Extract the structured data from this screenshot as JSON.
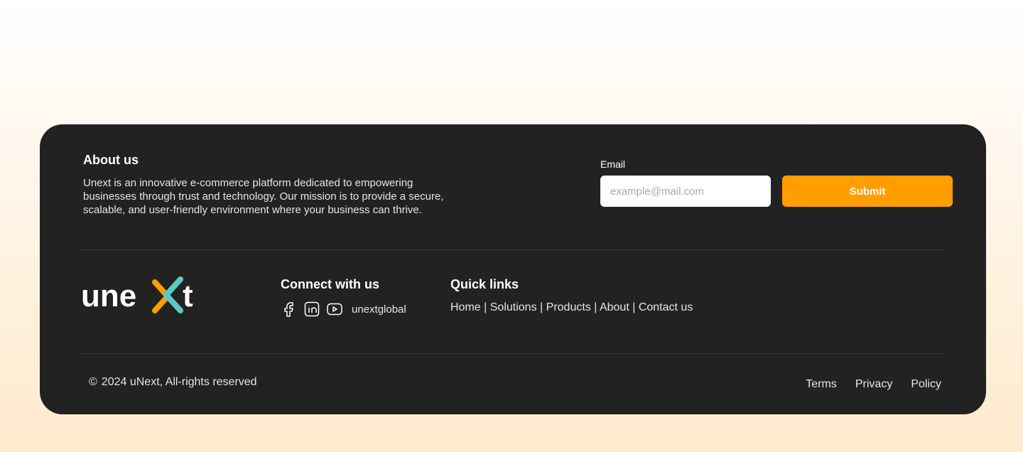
{
  "about": {
    "title": "About us",
    "text": "Unext is an innovative e-commerce platform dedicated to empowering businesses through trust and technology. Our mission is to provide a secure, scalable, and user-friendly environment where your business can thrive."
  },
  "newsletter": {
    "email_label": "Email",
    "email_placeholder": "example@mail.com",
    "email_value": "",
    "submit_label": "Submit"
  },
  "brand": {
    "logo_text": "unext",
    "colors": {
      "text": "#ffffff",
      "orange": "#ff9e00",
      "teal": "#5cc8c8"
    }
  },
  "connect": {
    "title": "Connect with us",
    "icons": [
      "facebook-icon",
      "linkedin-icon",
      "youtube-icon"
    ],
    "handle": "unextglobal"
  },
  "quick_links": {
    "title": "Quick links",
    "items": [
      "Home",
      "Solutions",
      "Products",
      "About",
      "Contact us"
    ],
    "separator": "|"
  },
  "bottom": {
    "copyright_symbol": "©",
    "copyright_text": "2024 uNext, All-rights reserved",
    "legal_links": [
      "Terms",
      "Privacy",
      "Policy"
    ]
  },
  "colors": {
    "footer_bg": "#222222",
    "accent": "#ff9e00"
  }
}
